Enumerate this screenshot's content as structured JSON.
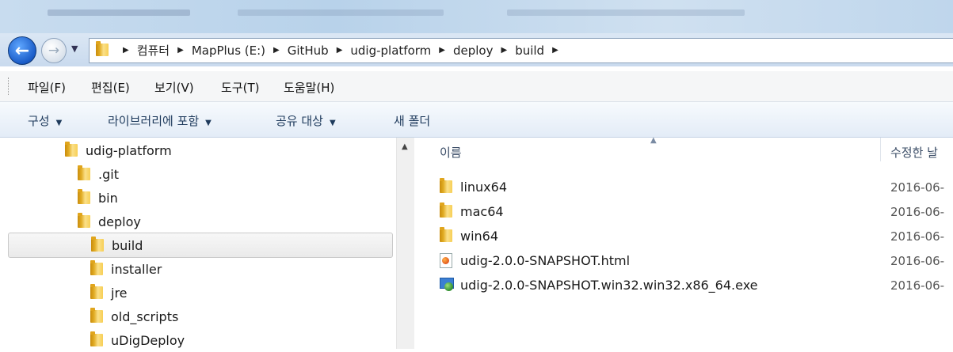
{
  "address": {
    "crumbs": [
      "컴퓨터",
      "MapPlus (E:)",
      "GitHub",
      "udig-platform",
      "deploy",
      "build"
    ]
  },
  "menu": [
    "파일(F)",
    "편집(E)",
    "보기(V)",
    "도구(T)",
    "도움말(H)"
  ],
  "toolbar": {
    "organize": "구성",
    "include_library": "라이브러리에 포함",
    "share_with": "공유 대상",
    "new_folder": "새 폴더"
  },
  "tree": [
    {
      "label": "udig-platform",
      "level": 0,
      "selected": false
    },
    {
      "label": ".git",
      "level": 1,
      "selected": false
    },
    {
      "label": "bin",
      "level": 1,
      "selected": false
    },
    {
      "label": "deploy",
      "level": 1,
      "selected": false
    },
    {
      "label": "build",
      "level": 2,
      "selected": true
    },
    {
      "label": "installer",
      "level": 2,
      "selected": false
    },
    {
      "label": "jre",
      "level": 2,
      "selected": false
    },
    {
      "label": "old_scripts",
      "level": 2,
      "selected": false
    },
    {
      "label": "uDigDeploy",
      "level": 2,
      "selected": false
    }
  ],
  "columns": {
    "name": "이름",
    "modified": "수정한 날"
  },
  "files": [
    {
      "name": "linux64",
      "type": "folder",
      "date": "2016-06-"
    },
    {
      "name": "mac64",
      "type": "folder",
      "date": "2016-06-"
    },
    {
      "name": "win64",
      "type": "folder",
      "date": "2016-06-"
    },
    {
      "name": "udig-2.0.0-SNAPSHOT.html",
      "type": "html",
      "date": "2016-06-"
    },
    {
      "name": "udig-2.0.0-SNAPSHOT.win32.win32.x86_64.exe",
      "type": "exe",
      "date": "2016-06-"
    }
  ],
  "icons": {
    "back": "back-arrow-icon",
    "forward": "forward-arrow-icon",
    "folder": "folder-icon",
    "html": "html-file-icon",
    "exe": "exe-file-icon"
  }
}
